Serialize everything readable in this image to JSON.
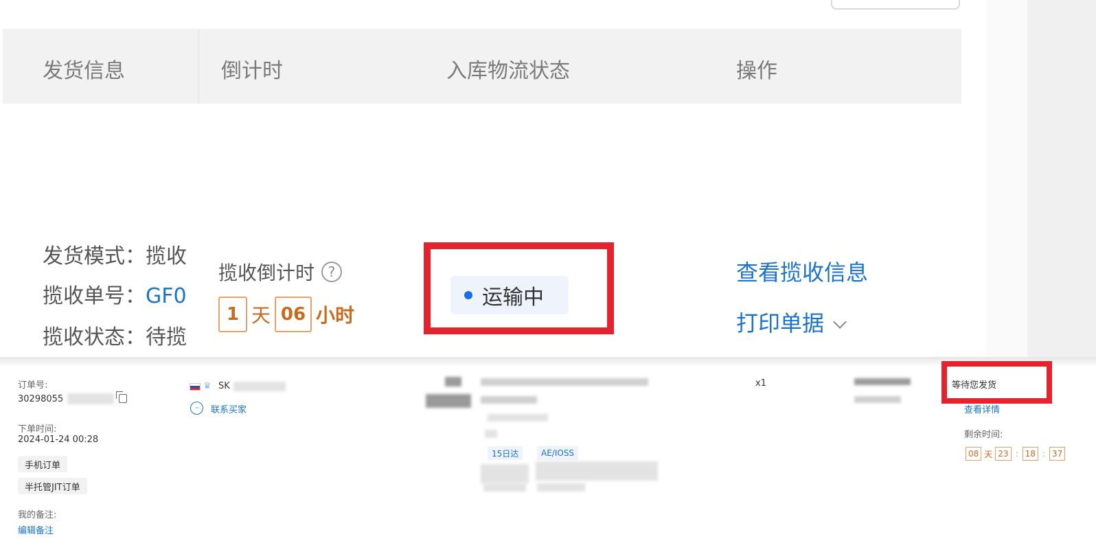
{
  "top_table": {
    "headers": {
      "shipping_info": "发货信息",
      "countdown": "倒计时",
      "inbound_status": "入库物流状态",
      "operation": "操作"
    },
    "shipping_fields": [
      {
        "label": "发货模式：",
        "value": "揽收"
      },
      {
        "label": "揽收单号：",
        "value": "GF0"
      },
      {
        "label": "揽收状态：",
        "value": "待揽"
      }
    ],
    "countdown": {
      "title": "揽收倒计时",
      "help_glyph": "?",
      "days": "1",
      "days_unit": "天",
      "hours": "06",
      "hours_unit": "小时"
    },
    "status": {
      "label": "运输中",
      "dot_color": "#1a6fe0"
    },
    "operations": {
      "view_pickup": "查看揽收信息",
      "print_docs": "打印单据"
    },
    "highlight_color": "#e3232e"
  },
  "order_row": {
    "order_no_label": "订单号:",
    "order_no": "30298055",
    "order_time_label": "下单时间:",
    "order_time": "2024-01-24 00:28",
    "tags": [
      "手机订单",
      "半托管JIT订单"
    ],
    "remark_label": "我的备注:",
    "edit_remark": "编辑备注",
    "buyer_prefix": "SK",
    "contact_buyer": "联系买家",
    "chips": [
      "15日达",
      "AE/IOSS"
    ],
    "quantity": "x1",
    "status_text": "等待您发货",
    "view_details": "查看详情",
    "remaining_label": "剩余时间:",
    "remaining": {
      "days": "08",
      "days_unit": "天",
      "hours": "23",
      "minutes": "18",
      "seconds": "37",
      "separator": ":"
    }
  }
}
